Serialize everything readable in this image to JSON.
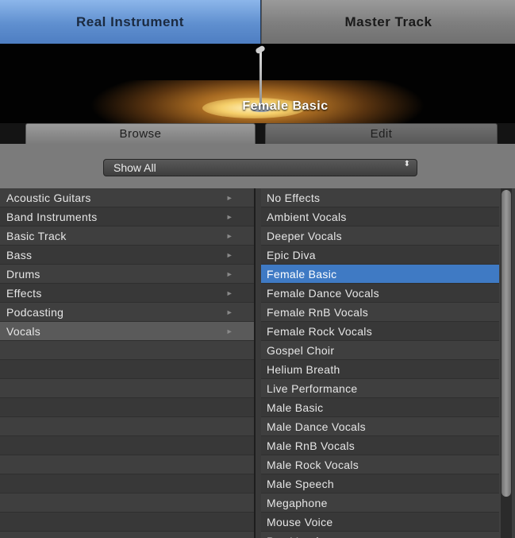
{
  "top_tabs": {
    "active": "Real Instrument",
    "inactive": "Master Track"
  },
  "stage": {
    "patch_name": "Female Basic"
  },
  "sub_tabs": {
    "browse": "Browse",
    "edit": "Edit"
  },
  "filter": {
    "selected": "Show All",
    "arrows_glyph": "⬍"
  },
  "categories": [
    "Acoustic Guitars",
    "Band Instruments",
    "Basic Track",
    "Bass",
    "Drums",
    "Effects",
    "Podcasting",
    "Vocals"
  ],
  "selected_category": "Vocals",
  "chevron_glyph": "►",
  "presets": [
    "No Effects",
    "Ambient Vocals",
    "Deeper Vocals",
    "Epic Diva",
    "Female Basic",
    "Female Dance Vocals",
    "Female RnB Vocals",
    "Female Rock Vocals",
    "Gospel Choir",
    "Helium Breath",
    "Live Performance",
    "Male Basic",
    "Male Dance Vocals",
    "Male RnB Vocals",
    "Male Rock Vocals",
    "Male Speech",
    "Megaphone",
    "Mouse Voice",
    "Pop Vocals"
  ],
  "selected_preset": "Female Basic",
  "colors": {
    "accent": "#3f7ac4",
    "tab_active": "#6f9fdc",
    "background": "#3f3f3f"
  }
}
